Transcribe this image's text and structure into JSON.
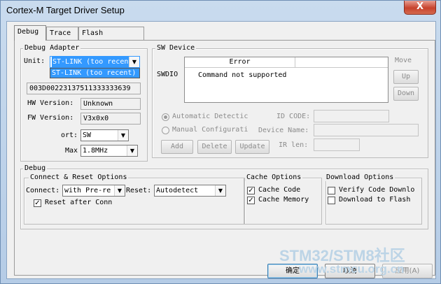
{
  "window": {
    "title": "Cortex-M Target Driver Setup",
    "close": "X"
  },
  "tabs": [
    "Debug",
    "Trace",
    "Flash Download"
  ],
  "debug_adapter": {
    "label": "Debug Adapter",
    "unit_label": "Unit:",
    "unit_value": "ST-LINK (too recen",
    "dropdown_option": "ST-LINK (too recent)",
    "serial": "003D00223137511333333639",
    "hw_label": "HW Version:",
    "hw_value": "Unknown",
    "fw_label": "FW Version:",
    "fw_value": "V3x0x0",
    "port_label": "ort:",
    "port_value": "SW",
    "max_label": "Max",
    "max_value": "1.8MHz"
  },
  "sw_device": {
    "label": "SW Device",
    "swdio_label": "SWDIO",
    "move_label": "Move",
    "up": "Up",
    "down": "Down",
    "error_header": "Error",
    "error_text": "Command not supported",
    "auto_detect": "Automatic Detectic",
    "manual_config": "Manual Configurati",
    "id_code": "ID CODE:",
    "device_name": "Device Name:",
    "ir_len": "IR len:",
    "add": "Add",
    "delete": "Delete",
    "update": "Update"
  },
  "debug": {
    "label": "Debug",
    "connect_reset": {
      "label": "Connect & Reset Options",
      "connect_label": "Connect:",
      "connect_value": "with Pre-re",
      "reset_label": "Reset:",
      "reset_value": "Autodetect",
      "reset_after": "Reset after Conn"
    },
    "cache": {
      "label": "Cache Options",
      "cache_code": "Cache Code",
      "cache_memory": "Cache Memory"
    },
    "download": {
      "label": "Download Options",
      "verify": "Verify Code Downlo",
      "flash": "Download to Flash"
    }
  },
  "footer": {
    "ok": "确定",
    "cancel": "取消",
    "apply": "应用(A)"
  },
  "watermark": {
    "line1": "STM32/STM8社区",
    "line2": "www.stmcu.org.cn"
  }
}
